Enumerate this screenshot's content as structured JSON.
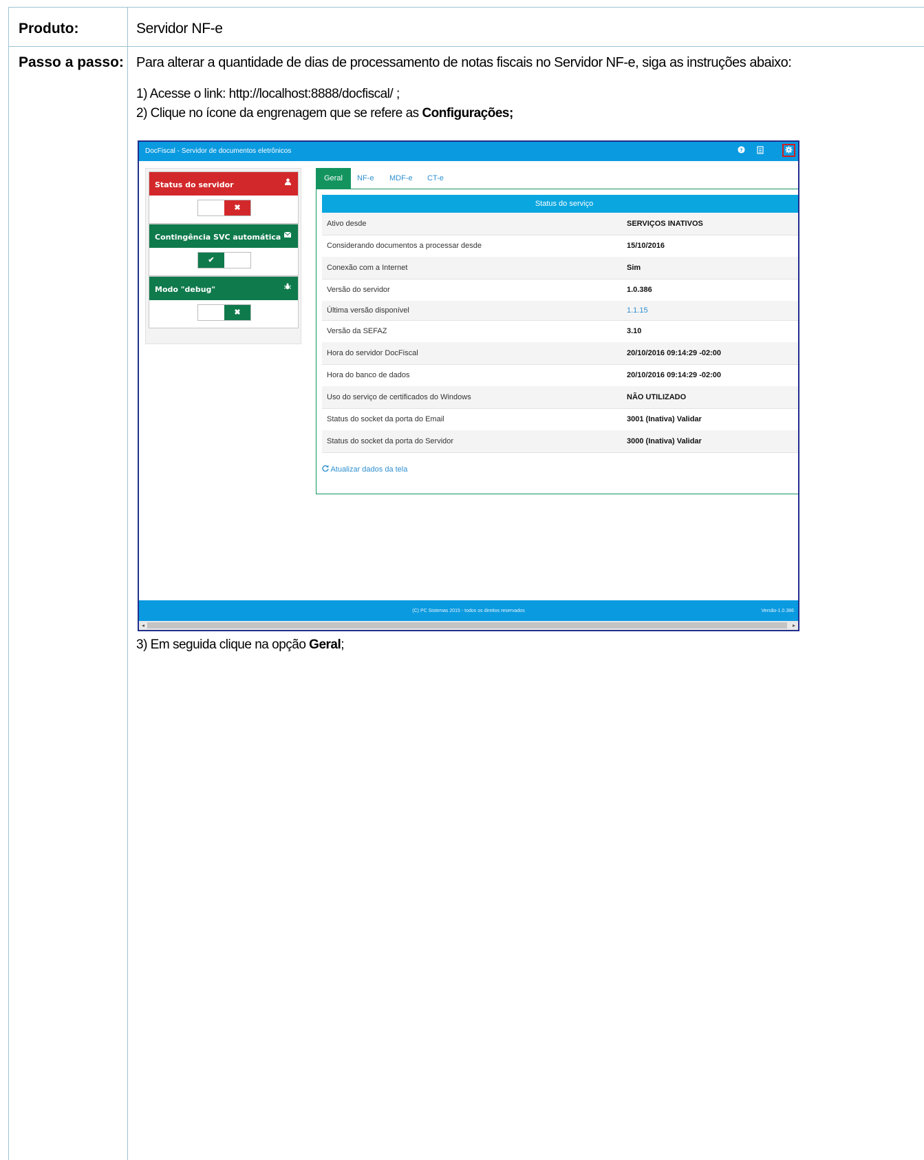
{
  "doc": {
    "product_label": "Produto:",
    "product_value": "Servidor NF-e",
    "steps_label": "Passo a passo:",
    "intro": "Para alterar a quantidade de dias de processamento de notas fiscais no Servidor NF-e, siga as instruções abaixo:",
    "step1": "1) Acesse o link: http://localhost:8888/docfiscal/ ;",
    "step2_prefix": "2) Clique no ícone da engrenagem que se refere as ",
    "step2_bold": "Configurações;",
    "step3_prefix": "3) Em seguida clique na opção ",
    "step3_bold": "Geral",
    "step3_suffix": ";"
  },
  "app": {
    "title": "DocFiscal - Servidor de documentos eletrônicos",
    "icons": [
      "help-icon",
      "document-icon",
      "gear-icon"
    ],
    "cards": [
      {
        "title": "Status do servidor",
        "icon": "user-icon",
        "color": "#d3282b",
        "state": "off"
      },
      {
        "title": "Contingência SVC automática",
        "icon": "envelope-icon",
        "color": "#0f7a4c",
        "state": "on"
      },
      {
        "title": "Modo \"debug\"",
        "icon": "bug-icon",
        "color": "#0f7a4c",
        "state": "off"
      }
    ],
    "tabs": [
      "Geral",
      "NF-e",
      "MDF-e",
      "CT-e"
    ],
    "active_tab": "Geral",
    "service_header": "Status do serviço",
    "rows": [
      {
        "key": "Ativo desde",
        "value": "SERVIÇOS INATIVOS"
      },
      {
        "key": "Considerando documentos a processar desde",
        "value": "15/10/2016"
      },
      {
        "key": "Conexão com a Internet",
        "value": "Sim"
      },
      {
        "key": "Versão do servidor",
        "value": "1.0.386"
      },
      {
        "key": "Última versão disponível",
        "value": "1.1.15"
      },
      {
        "key": "Versão da SEFAZ",
        "value": "3.10"
      },
      {
        "key": "Hora do servidor DocFiscal",
        "value": "20/10/2016 09:14:29 -02:00"
      },
      {
        "key": "Hora do banco de dados",
        "value": "20/10/2016 09:14:29 -02:00"
      },
      {
        "key": "Uso do serviço de certificados do Windows",
        "value": "NÃO UTILIZADO"
      },
      {
        "key": "Status do socket da porta do Email",
        "value": "3001 (Inativa) Validar"
      },
      {
        "key": "Status do socket da porta do Servidor",
        "value": "3000 (Inativa) Validar"
      }
    ],
    "refresh_label": "Atualizar dados da tela",
    "footer": "(C) PC Sistemas 2015 - todos os direitos reservados",
    "version": "Versão-1.0.386"
  }
}
